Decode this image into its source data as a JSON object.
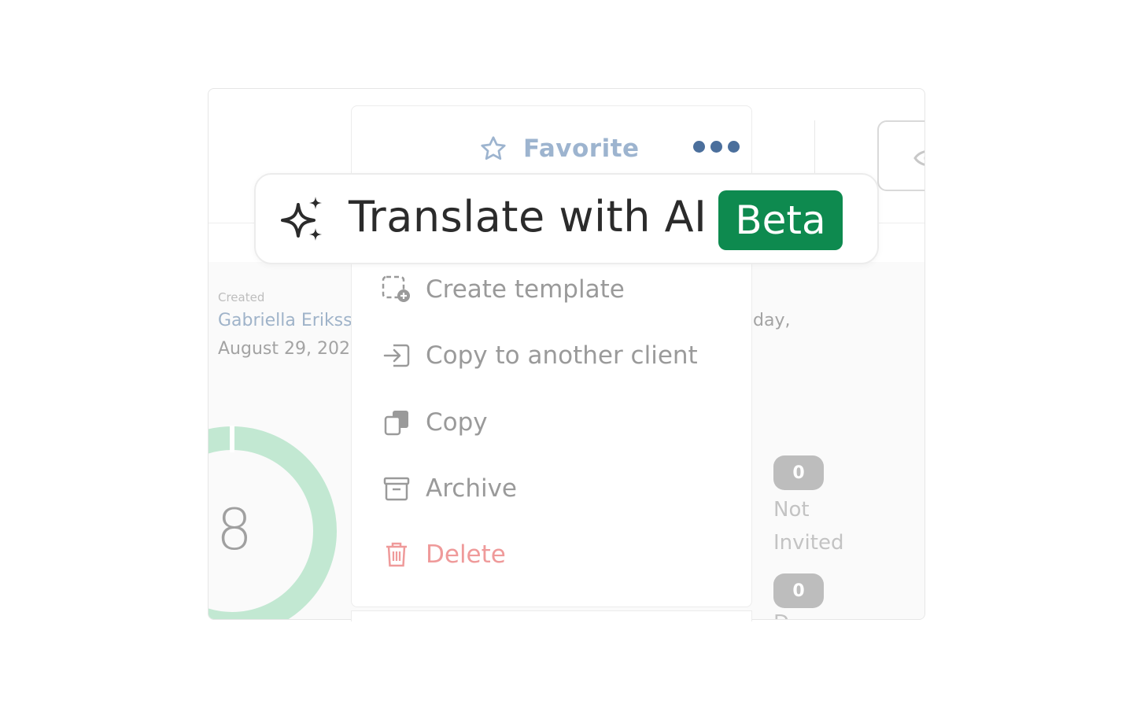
{
  "background_card": {
    "created_caption": "Created",
    "owner_name": "Gabriella Erikss",
    "created_date": "August 29, 202",
    "partial_text": "day,",
    "donut_value": "8",
    "stats": [
      {
        "count": "0",
        "label": "Not Invited"
      },
      {
        "count": "0",
        "label": "D"
      }
    ]
  },
  "menu": {
    "favorite_label": "Favorite",
    "items": [
      {
        "label": "Create template",
        "icon": "template-add-icon"
      },
      {
        "label": "Copy to another client",
        "icon": "copy-to-client-icon"
      },
      {
        "label": "Copy",
        "icon": "copy-icon"
      },
      {
        "label": "Archive",
        "icon": "archive-icon"
      },
      {
        "label": "Delete",
        "icon": "trash-icon"
      }
    ]
  },
  "callout": {
    "label": "Translate with AI",
    "badge": "Beta",
    "icon": "sparkle-icon"
  },
  "colors": {
    "beta_badge": "#0e8a4f",
    "delete_text": "#ef9a9a",
    "favorite_text": "#9db4cf",
    "more_dots": "#4b6f9c",
    "donut": "#c2e8d2"
  }
}
